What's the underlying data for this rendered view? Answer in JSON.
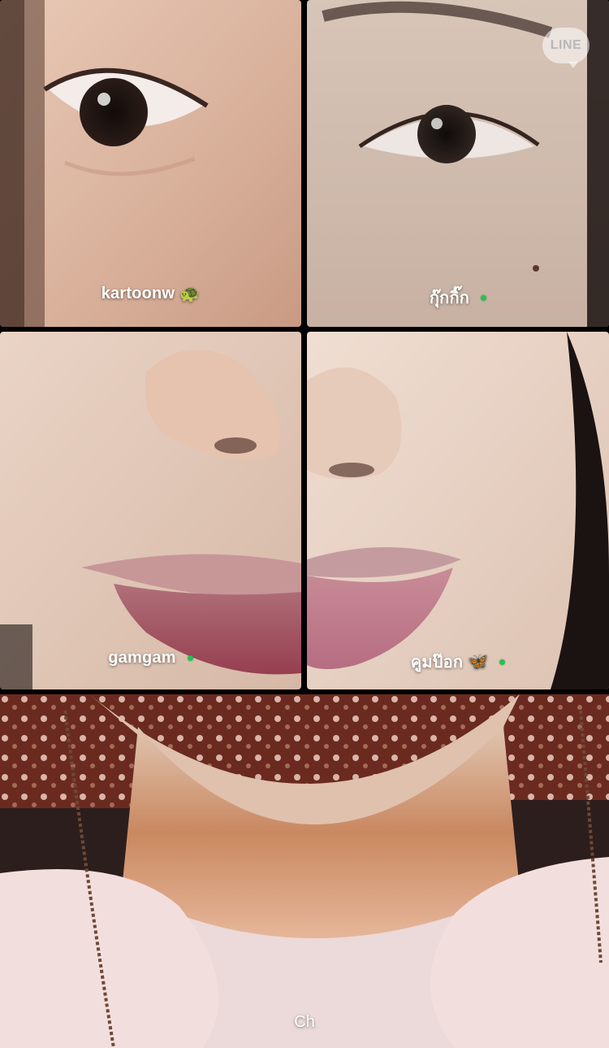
{
  "participants": [
    {
      "name": "kartoonw",
      "emoji": "🐢",
      "online": false
    },
    {
      "name": "กุ๊กกิ๊ก",
      "emoji": "",
      "online": true
    },
    {
      "name": "gamgam",
      "emoji": "",
      "online": true
    },
    {
      "name": "คูมป๊อก",
      "emoji": "🦋",
      "online": true
    }
  ],
  "self_view": {
    "label": "Ch"
  },
  "watermark": {
    "text": "LINE"
  },
  "colors": {
    "online_dot": "#1fc352",
    "background": "#000000"
  }
}
